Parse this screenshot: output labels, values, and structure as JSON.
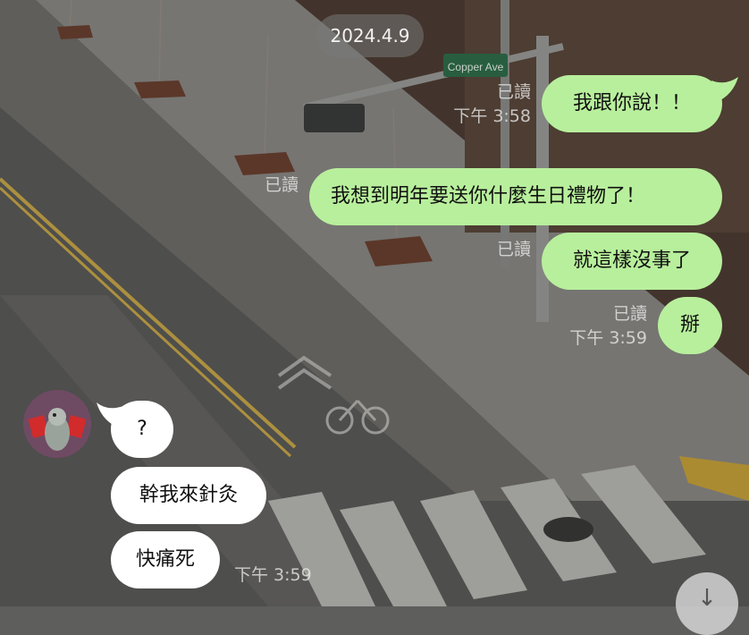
{
  "chat": {
    "date": "2024.4.9",
    "outgoing": [
      {
        "text": "我跟你說！！",
        "read": "已讀",
        "time": "下午 3:58"
      },
      {
        "text": "我想到明年要送你什麼生日禮物了！",
        "read": "已讀",
        "time": ""
      },
      {
        "text": "就這樣沒事了",
        "read": "已讀",
        "time": ""
      },
      {
        "text": "掰",
        "read": "已讀",
        "time": "下午 3:59"
      }
    ],
    "incoming": [
      {
        "text": "?"
      },
      {
        "text": "幹我來針灸"
      },
      {
        "text": "快痛死",
        "time": "下午 3:59"
      }
    ],
    "scroll_down_icon": "arrow-down-icon"
  },
  "background": {
    "street_sign": "Copper Ave"
  },
  "colors": {
    "outgoing_bubble": "#b8ef9c",
    "incoming_bubble": "#ffffff"
  }
}
